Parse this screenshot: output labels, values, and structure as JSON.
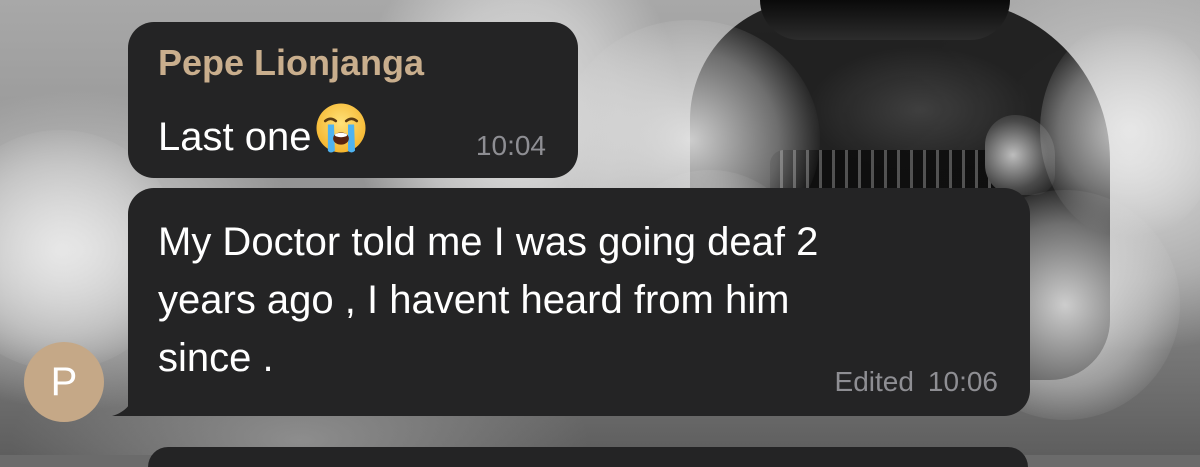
{
  "messages": [
    {
      "sender": "Pepe Lionjanga",
      "text": "Last one",
      "emoji_icon": "loudly-crying-face-icon",
      "time": "10:04"
    },
    {
      "text_lines": [
        "My Doctor told me I was going deaf 2",
        "years ago , I havent heard from him",
        "since ."
      ],
      "edited_label": "Edited",
      "time": "10:06"
    }
  ],
  "avatar": {
    "initial": "P",
    "color": "#c5a887"
  },
  "colors": {
    "bubble": "#242425",
    "sender_name": "#c9ae8d",
    "meta": "#8e8e93"
  }
}
